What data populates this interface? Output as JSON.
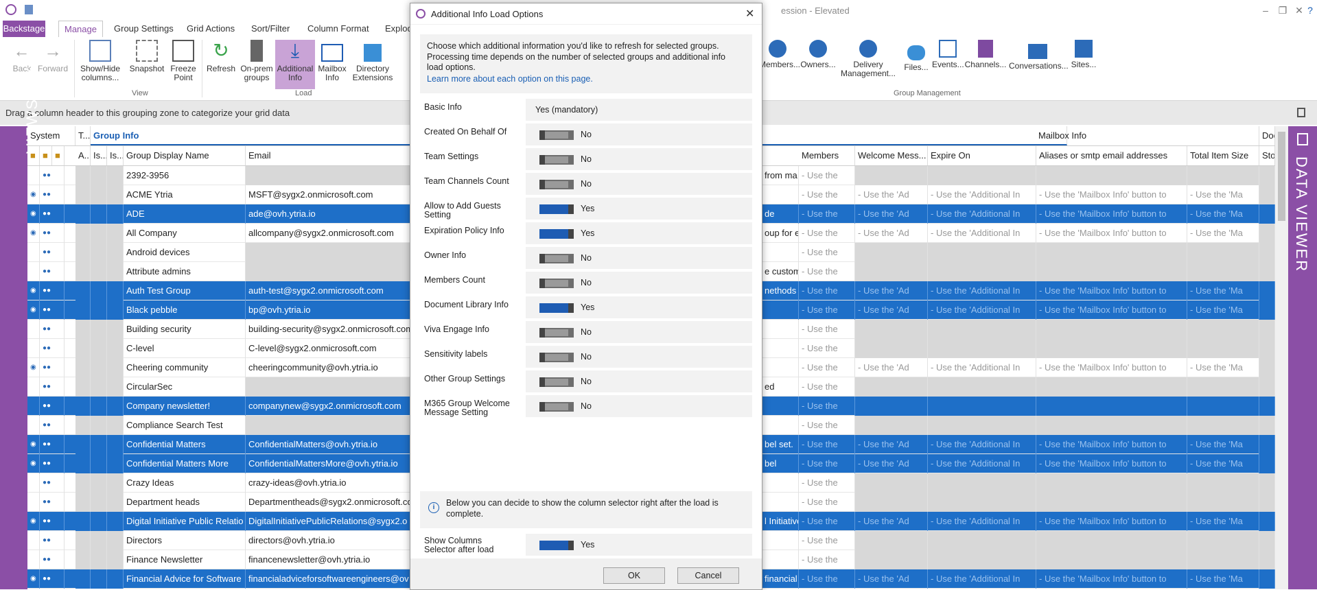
{
  "window": {
    "title_fragment": "ession - Elevated"
  },
  "ribbon_tabs": [
    "Backstage",
    "Manage",
    "Group Settings",
    "Grid Actions",
    "Sort/Filter",
    "Column Format",
    "Explod"
  ],
  "ribbon_buttons": {
    "back": "Back",
    "forward": "Forward",
    "show_hide": "Show/Hide",
    "columns": "columns...",
    "snapshot": "Snapshot",
    "freeze": "Freeze",
    "point": "Point",
    "refresh": "Refresh",
    "onprem": "On-prem",
    "groups": "groups",
    "additional": "Additional",
    "info": "Info",
    "mailbox": "Mailbox",
    "mailbox_info": "Info",
    "directory": "Directory",
    "extensions": "Extensions",
    "members": "Members...",
    "owners": "Owners...",
    "delivery": "Delivery",
    "management": "Management...",
    "files": "Files...",
    "events": "Events...",
    "channels": "Channels...",
    "conversations": "Conversations...",
    "sites": "Sites..."
  },
  "ribbon_groups": {
    "view": "View",
    "load": "Load",
    "group_management": "Group Management"
  },
  "grouping_zone": "Drag a column header to this grouping zone to categorize your grid data",
  "side_left": "VIEWS / JOBS",
  "side_right": "DATA VIEWER",
  "grid": {
    "band_headers": {
      "system": "System",
      "t": "T...",
      "group_info": "Group Info",
      "mailbox_info": "Mailbox Info",
      "do": "Doc"
    },
    "columns": {
      "a": "A...",
      "is1": "Is...",
      "is2": "Is...",
      "name": "Group Display Name",
      "email": "Email",
      "members": "Members",
      "welcome": "Welcome Mess...",
      "expire": "Expire On",
      "aliases": "Aliases or smtp email addresses",
      "total": "Total Item Size",
      "sto": "Sto"
    },
    "pending_members": "- Use the",
    "pending_welcome": "- Use the 'Ad",
    "pending_expire": "- Use the 'Additional In",
    "pending_aliases": "- Use the 'Mailbox Info' button to",
    "pending_total": "- Use the 'Ma",
    "rows": [
      {
        "name": "2392-3956",
        "email": "",
        "mid": "from ma",
        "sel": false,
        "full": false
      },
      {
        "name": "ACME Ytria",
        "email": "MSFT@sygx2.onmicrosoft.com",
        "mid": "",
        "sel": false,
        "full": true
      },
      {
        "name": "ADE",
        "email": "ade@ovh.ytria.io",
        "mid": "de",
        "sel": true,
        "full": true
      },
      {
        "name": "All Company",
        "email": "allcompany@sygx2.onmicrosoft.com",
        "mid": "oup for e",
        "sel": false,
        "full": true
      },
      {
        "name": "Android devices",
        "email": "",
        "mid": "",
        "sel": false,
        "full": false
      },
      {
        "name": "Attribute admins",
        "email": "",
        "mid": "e custom",
        "sel": false,
        "full": false
      },
      {
        "name": "Auth Test Group",
        "email": "auth-test@sygx2.onmicrosoft.com",
        "mid": "nethods c",
        "sel": true,
        "full": true
      },
      {
        "name": "Black pebble",
        "email": "bp@ovh.ytria.io",
        "mid": "",
        "sel": true,
        "full": true
      },
      {
        "name": "Building security",
        "email": "building-security@sygx2.onmicrosoft.com",
        "mid": "",
        "sel": false,
        "full": false
      },
      {
        "name": "C-level",
        "email": "C-level@sygx2.onmicrosoft.com",
        "mid": "",
        "sel": false,
        "full": false
      },
      {
        "name": "Cheering community",
        "email": "cheeringcommunity@ovh.ytria.io",
        "mid": "",
        "sel": false,
        "full": true
      },
      {
        "name": "CircularSec",
        "email": "",
        "mid": "ed",
        "sel": false,
        "full": false
      },
      {
        "name": "Company newsletter!",
        "email": "companynew@sygx2.onmicrosoft.com",
        "mid": "",
        "sel": true,
        "full": false
      },
      {
        "name": "Compliance Search Test",
        "email": "",
        "mid": "",
        "sel": false,
        "full": false
      },
      {
        "name": "Confidential Matters",
        "email": "ConfidentialMatters@ovh.ytria.io",
        "mid": "bel set.",
        "sel": true,
        "full": true
      },
      {
        "name": "Confidential Matters  More",
        "email": "ConfidentialMattersMore@ovh.ytria.io",
        "mid": "bel",
        "sel": true,
        "full": true
      },
      {
        "name": "Crazy Ideas",
        "email": "crazy-ideas@ovh.ytria.io",
        "mid": "",
        "sel": false,
        "full": false
      },
      {
        "name": "Department heads",
        "email": "Departmentheads@sygx2.onmicrosoft.com",
        "mid": "",
        "sel": false,
        "full": false
      },
      {
        "name": "Digital Initiative Public Relatio",
        "email": "DigitalInitiativePublicRelations@sygx2.o",
        "mid": "l Initiative",
        "sel": true,
        "full": true
      },
      {
        "name": "Directors",
        "email": "directors@ovh.ytria.io",
        "mid": "",
        "sel": false,
        "full": false
      },
      {
        "name": "Finance Newsletter",
        "email": "financenewsletter@ovh.ytria.io",
        "mid": "",
        "sel": false,
        "full": false
      },
      {
        "name": "Financial Advice for Software",
        "email": "financialadviceforsoftwareengineers@ov",
        "mid": "financial",
        "sel": true,
        "full": true
      }
    ]
  },
  "dialog": {
    "title": "Additional Info Load Options",
    "intro": "Choose which additional information you'd like to refresh for selected groups. Processing time depends on the number of selected groups and additional info load options.",
    "link": "Learn more about each option on this page.",
    "options": [
      {
        "label": "Basic Info",
        "value": "Yes (mandatory)",
        "mandatory": true,
        "on": true
      },
      {
        "label": "Created On Behalf Of",
        "value": "No",
        "on": false
      },
      {
        "label": "Team Settings",
        "value": "No",
        "on": false
      },
      {
        "label": "Team Channels Count",
        "value": "No",
        "on": false
      },
      {
        "label": "Allow to Add Guests Setting",
        "value": "Yes",
        "on": true
      },
      {
        "label": "Expiration Policy Info",
        "value": "Yes",
        "on": true
      },
      {
        "label": "Owner Info",
        "value": "No",
        "on": false
      },
      {
        "label": "Members Count",
        "value": "No",
        "on": false
      },
      {
        "label": "Document Library Info",
        "value": "Yes",
        "on": true
      },
      {
        "label": "Viva Engage Info",
        "value": "No",
        "on": false
      },
      {
        "label": "Sensitivity labels",
        "value": "No",
        "on": false
      },
      {
        "label": "Other Group Settings",
        "value": "No",
        "on": false
      },
      {
        "label": "M365 Group Welcome Message Setting",
        "value": "No",
        "on": false
      }
    ],
    "info_note": "Below you can decide to show the column selector right after the load is complete.",
    "show_columns": {
      "label": "Show Columns Selector after load",
      "value": "Yes",
      "on": true
    },
    "ok": "OK",
    "cancel": "Cancel"
  },
  "colors": {
    "accent": "#8b4fa6",
    "selection": "#1e6fc8",
    "toggle_on": "#1e5cb3"
  }
}
